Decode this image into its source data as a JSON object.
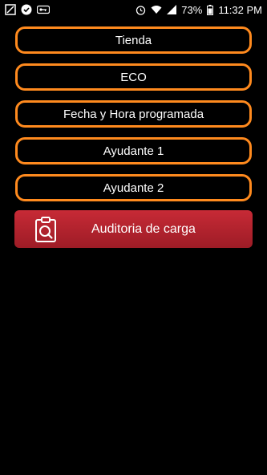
{
  "status_bar": {
    "battery_percent": "73%",
    "time": "11:32 PM",
    "left_icons": [
      "screenshot-icon",
      "checkmark-badge-icon",
      "vpn-key-icon"
    ],
    "right_icons": [
      "alarm-icon",
      "wifi-icon",
      "signal-icon",
      "battery-icon"
    ]
  },
  "form": {
    "fields": [
      {
        "label": "Tienda"
      },
      {
        "label": "ECO"
      },
      {
        "label": "Fecha y Hora programada"
      },
      {
        "label": "Ayudante 1"
      },
      {
        "label": "Ayudante 2"
      }
    ],
    "action_button": {
      "label": "Auditoria de carga",
      "icon": "clipboard-search-icon"
    }
  },
  "colors": {
    "field_border": "#ff8a1e",
    "action_button": "#b8222e",
    "background": "#000000"
  }
}
